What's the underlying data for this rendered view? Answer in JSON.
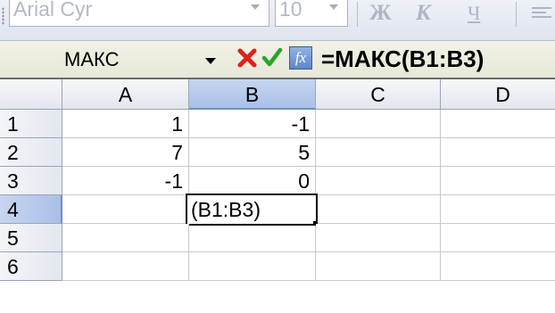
{
  "toolbar": {
    "font_name": "Arial Cyr",
    "font_size": "10",
    "bold_label": "Ж",
    "italic_label": "К",
    "underline_label": "Ч"
  },
  "formula_bar": {
    "name_box": "МАКС",
    "cancel_icon": "x-icon",
    "enter_icon": "checkmark-icon",
    "function_icon": "fx-icon",
    "function_label": "fx",
    "formula": "=МАКС(B1:B3)"
  },
  "columns": [
    "A",
    "B",
    "C",
    "D"
  ],
  "active_column": "B",
  "rows": [
    {
      "label": "1",
      "cells": [
        "1",
        "-1",
        "",
        ""
      ]
    },
    {
      "label": "2",
      "cells": [
        "7",
        "5",
        "",
        ""
      ]
    },
    {
      "label": "3",
      "cells": [
        "-1",
        "0",
        "",
        ""
      ]
    },
    {
      "label": "4",
      "cells": [
        "",
        "(B1:B3)",
        "",
        ""
      ]
    },
    {
      "label": "5",
      "cells": [
        "",
        "",
        "",
        ""
      ]
    },
    {
      "label": "6",
      "cells": [
        "",
        "",
        "",
        ""
      ]
    }
  ],
  "active_row": "4",
  "colors": {
    "cancel": "#e0201a",
    "enter": "#2aa52a",
    "header_active": "#a9c0e8"
  }
}
